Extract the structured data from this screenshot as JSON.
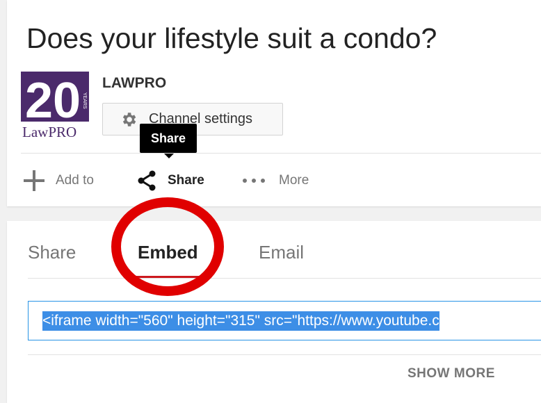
{
  "video": {
    "title": "Does your lifestyle suit a condo?"
  },
  "channel": {
    "name": "LAWPRO",
    "logo_number": "20",
    "logo_years": "YEARS",
    "logo_text": "LawPRO",
    "settings_label": "Channel settings"
  },
  "tooltip": {
    "label": "Share"
  },
  "actions": {
    "add_to": "Add to",
    "share": "Share",
    "more": "More"
  },
  "tabs": {
    "share": "Share",
    "embed": "Embed",
    "email": "Email"
  },
  "embed": {
    "code": "<iframe width=\"560\" height=\"315\" src=\"https://www.youtube.c"
  },
  "footer": {
    "show_more": "SHOW MORE"
  },
  "colors": {
    "accent_red": "#cc181e",
    "annotation_red": "#e00000",
    "selection_blue": "#3d8ee6",
    "logo_purple": "#4b2a6b"
  }
}
